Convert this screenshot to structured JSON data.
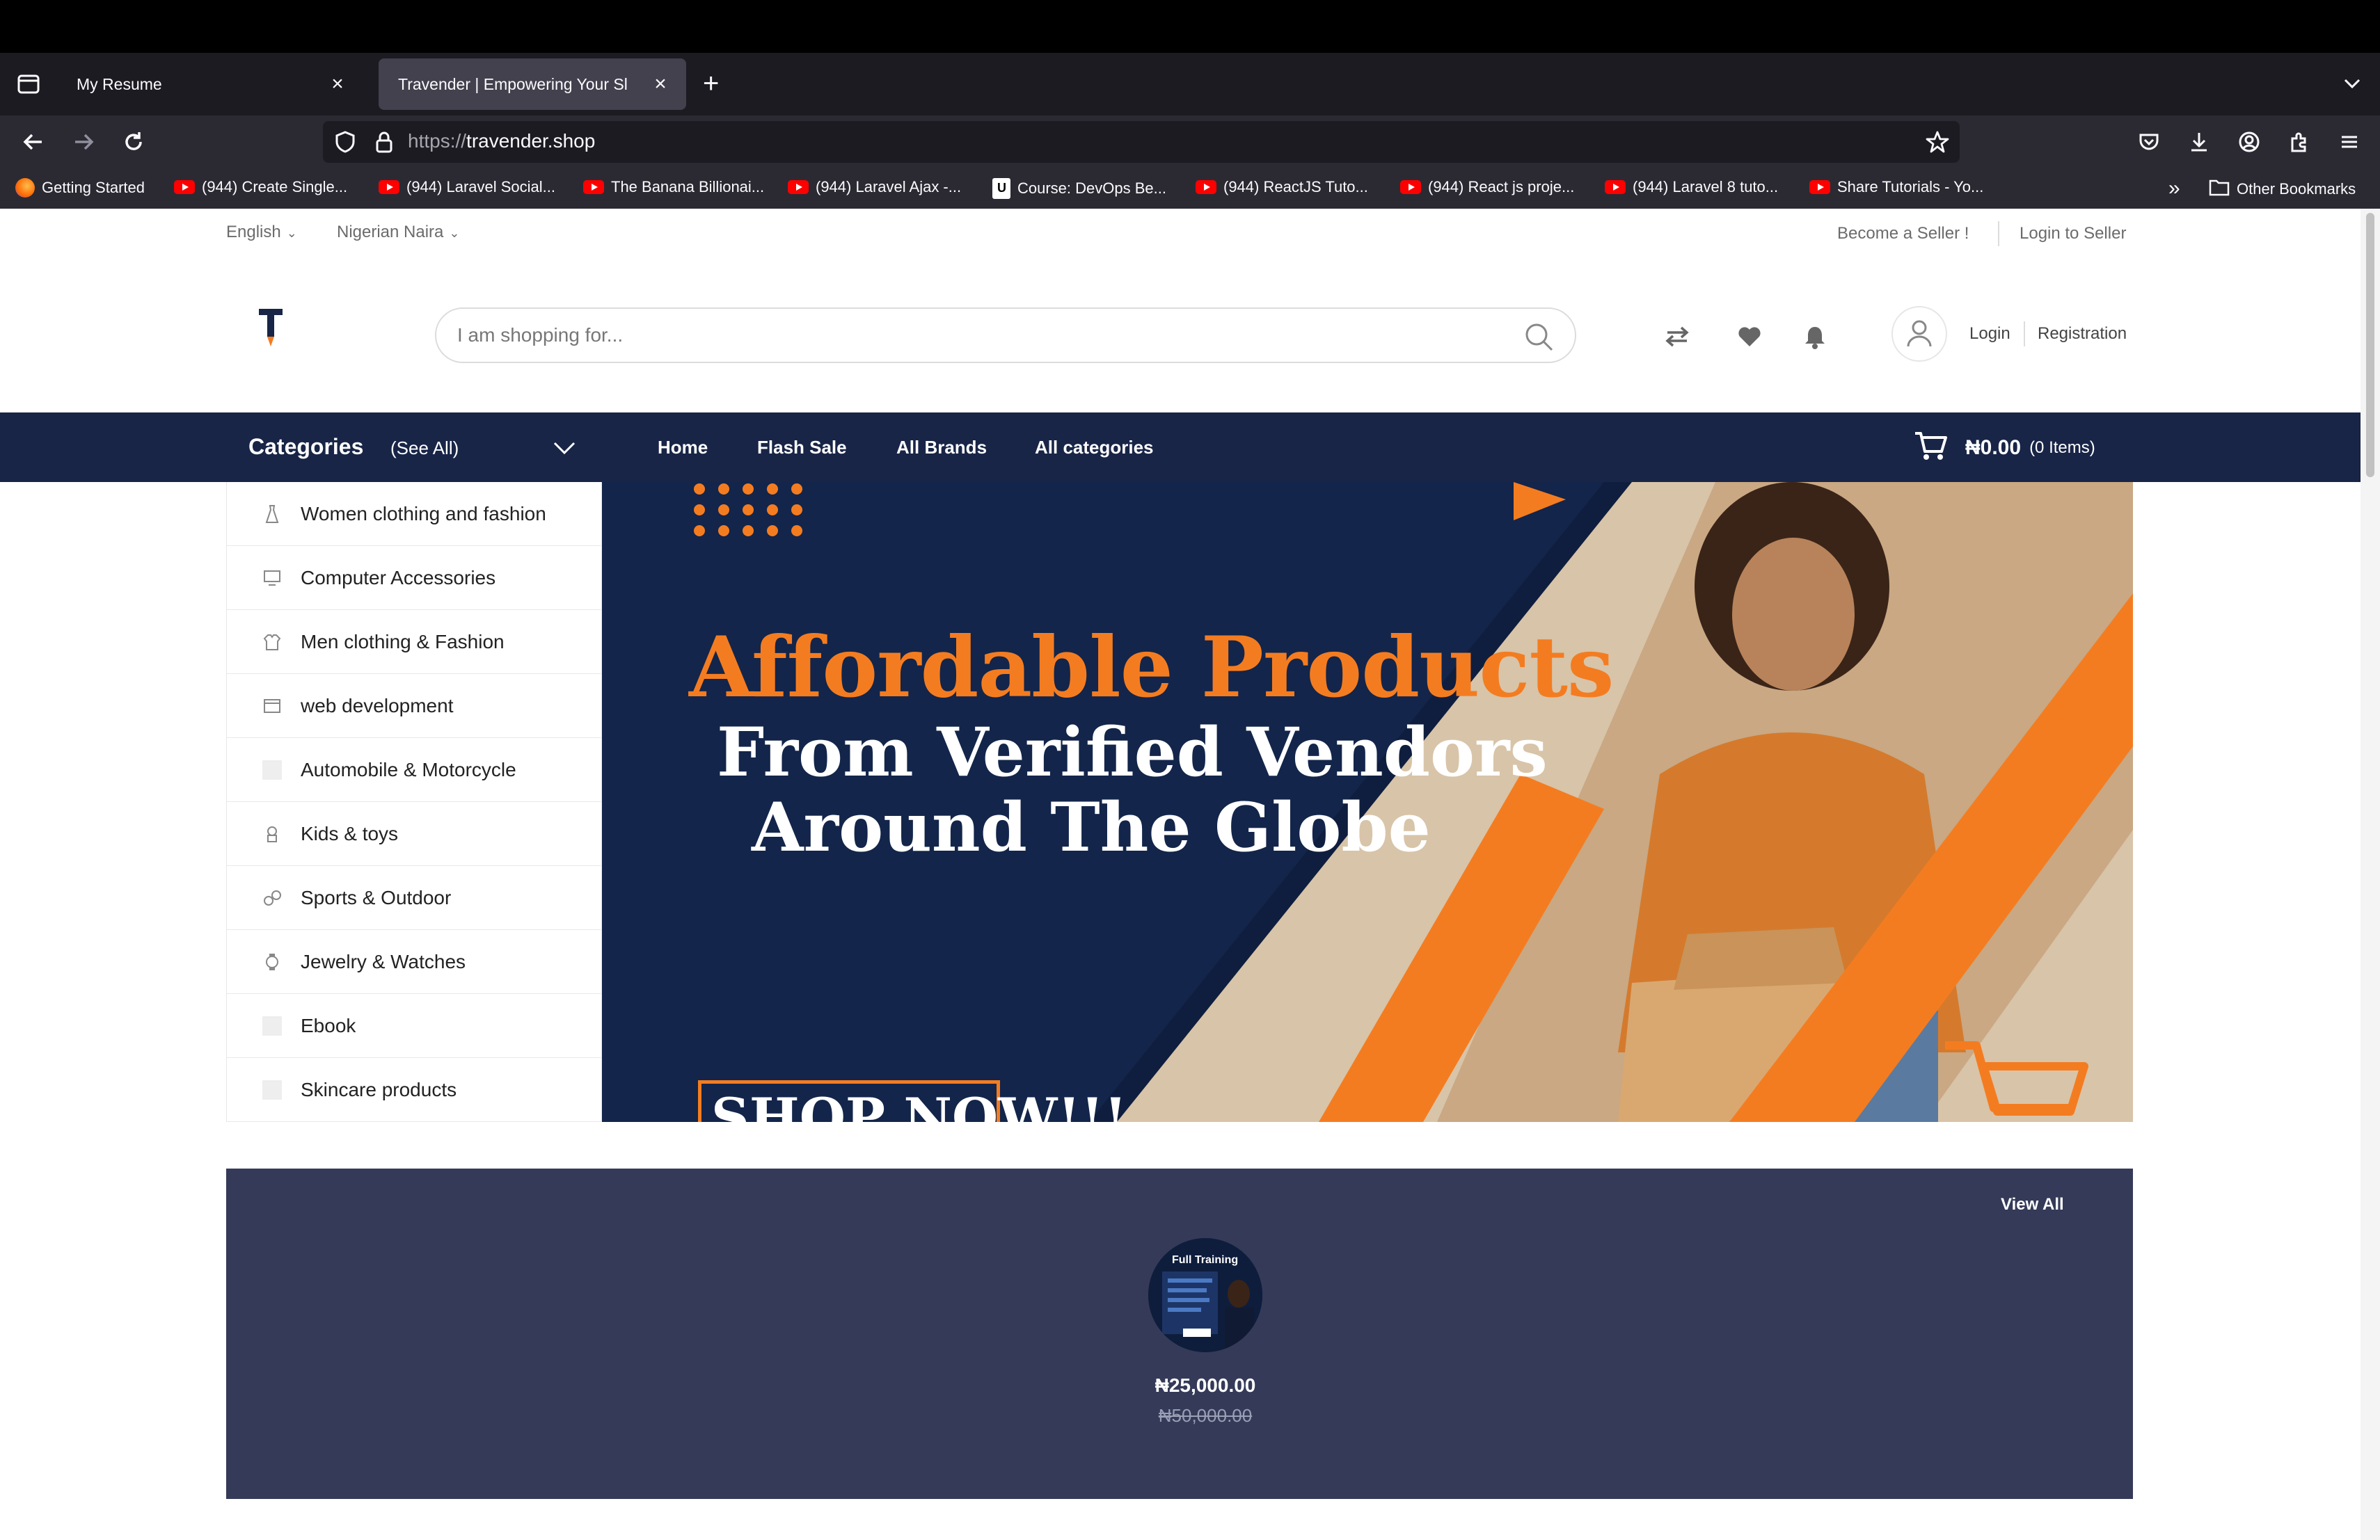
{
  "browser": {
    "tabs": [
      {
        "title": "My Resume",
        "active": false
      },
      {
        "title": "Travender | Empowering Your Sl",
        "active": true
      }
    ],
    "url_scheme": "https://",
    "url_host": "travender.shop",
    "bookmarks": [
      {
        "label": "Getting Started",
        "icon": "firefox-icon"
      },
      {
        "label": "(944) Create Single...",
        "icon": "youtube-icon"
      },
      {
        "label": "(944) Laravel Social...",
        "icon": "youtube-icon"
      },
      {
        "label": "The Banana Billionai...",
        "icon": "youtube-icon"
      },
      {
        "label": "(944) Laravel Ajax -...",
        "icon": "youtube-icon"
      },
      {
        "label": "Course: DevOps Be...",
        "icon": "udemy-icon"
      },
      {
        "label": "(944) ReactJS Tuto...",
        "icon": "youtube-icon"
      },
      {
        "label": "(944) React js proje...",
        "icon": "youtube-icon"
      },
      {
        "label": "(944) Laravel 8 tuto...",
        "icon": "youtube-icon"
      },
      {
        "label": "Share Tutorials - Yo...",
        "icon": "youtube-icon"
      }
    ],
    "other_bookmarks": "Other Bookmarks"
  },
  "topbar": {
    "language": "English",
    "currency": "Nigerian Naira",
    "become_seller": "Become a Seller !",
    "login_seller": "Login to Seller"
  },
  "header": {
    "logo_letter": "T",
    "search_placeholder": "I am shopping for...",
    "login": "Login",
    "registration": "Registration"
  },
  "nav": {
    "categories_title": "Categories",
    "see_all": "(See All)",
    "links": [
      "Home",
      "Flash Sale",
      "All Brands",
      "All categories"
    ],
    "cart_amount": "₦0.00",
    "cart_items": "(0 Items)"
  },
  "categories": [
    {
      "label": "Women clothing and fashion",
      "icon": "dress-icon"
    },
    {
      "label": "Computer Accessories",
      "icon": "computer-icon"
    },
    {
      "label": "Men clothing & Fashion",
      "icon": "men-clothing-icon"
    },
    {
      "label": "web development",
      "icon": "web-dev-icon"
    },
    {
      "label": "Automobile & Motorcycle",
      "icon": "placeholder-icon"
    },
    {
      "label": "Kids & toys",
      "icon": "toy-icon"
    },
    {
      "label": "Sports & Outdoor",
      "icon": "sports-icon"
    },
    {
      "label": "Jewelry & Watches",
      "icon": "watch-icon"
    },
    {
      "label": "Ebook",
      "icon": "placeholder-icon"
    },
    {
      "label": "Skincare products",
      "icon": "placeholder-icon"
    }
  ],
  "banner": {
    "line1": "Affordable Products",
    "line2": "From Verified Vendors",
    "line3": "Around The Globe",
    "cta": "SHOP NOW!!!"
  },
  "flash_deals": {
    "view_all": "View All",
    "product": {
      "thumb_title": "Full Training",
      "price": "₦25,000.00",
      "old_price": "₦50,000.00"
    }
  },
  "colors": {
    "navy": "#182547",
    "orange": "#f47c20",
    "flash_bg": "#343a58"
  }
}
